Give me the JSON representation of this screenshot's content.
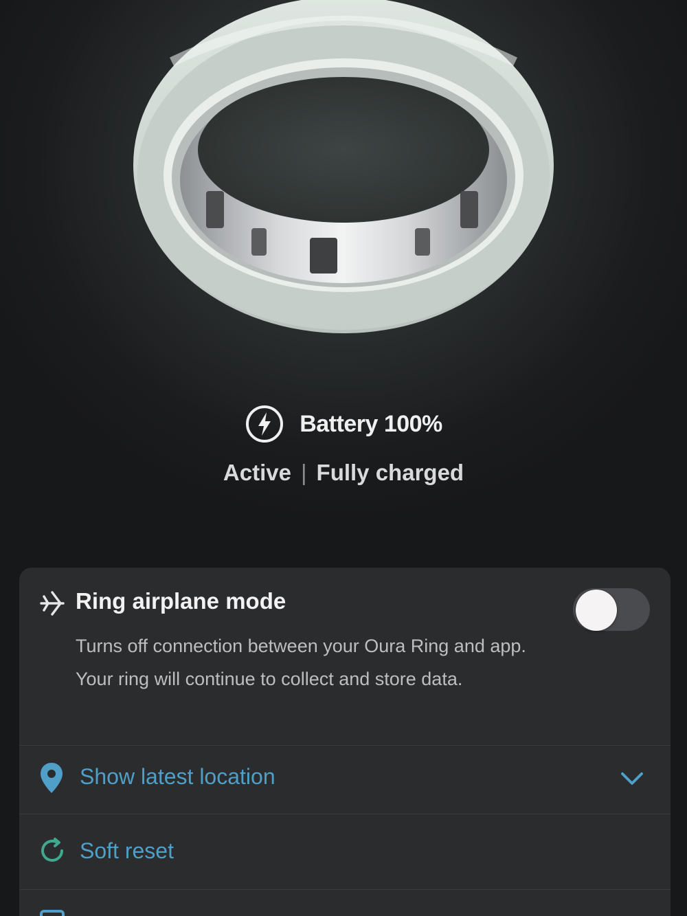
{
  "hero": {
    "image": "ring-image"
  },
  "battery": {
    "icon": "lightning-bolt-icon",
    "label": "Battery 100%",
    "state": "Active",
    "separator": "|",
    "charge_status": "Fully charged"
  },
  "settings": {
    "airplane_mode": {
      "icon": "airplane-mode-icon",
      "title": "Ring airplane mode",
      "description": "Turns off connection between your Oura Ring and app. Your ring will continue to collect and store data.",
      "enabled": false
    },
    "location": {
      "icon": "location-pin-icon",
      "label": "Show latest location",
      "chevron": "chevron-down-icon"
    },
    "soft_reset": {
      "icon": "soft-reset-icon",
      "label": "Soft reset"
    }
  },
  "colors": {
    "accent": "#4f9fc8",
    "card": "#2b2c2e",
    "background": "#1a1c1e"
  }
}
